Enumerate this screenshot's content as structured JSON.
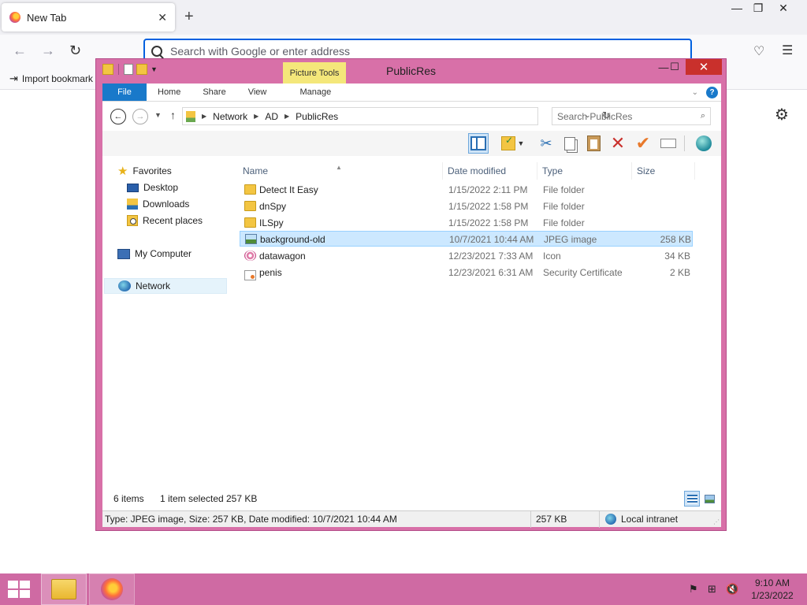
{
  "browser": {
    "tab_title": "New Tab",
    "tab_close": "✕",
    "new_tab": "+",
    "url_placeholder": "Search with Google or enter address",
    "bookmark_import_label": "Import bookmark",
    "window_controls": {
      "minimize": "—",
      "restore": "❐",
      "close": "✕"
    },
    "nav": {
      "back": "←",
      "forward": "→",
      "reload": "↻"
    },
    "icons": [
      "firefox-icon",
      "search-icon",
      "pocket-icon",
      "menu-icon",
      "gear-icon",
      "import-icon"
    ]
  },
  "explorer": {
    "title": "PublicRes",
    "contextual_tab": "Picture Tools",
    "window_controls": {
      "minimize": "—",
      "maximize": "☐",
      "close": "✕"
    },
    "ribbon_tabs": {
      "file": "File",
      "home": "Home",
      "share": "Share",
      "view": "View",
      "manage": "Manage"
    },
    "help_label": "?",
    "breadcrumb": [
      "Network",
      "AD",
      "PublicRes"
    ],
    "search_placeholder": "Search PublicRes",
    "navigation": {
      "favorites": "Favorites",
      "desktop": "Desktop",
      "downloads": "Downloads",
      "recent_places": "Recent places",
      "my_computer": "My Computer",
      "network": "Network"
    },
    "columns": {
      "name": "Name",
      "date_modified": "Date modified",
      "type": "Type",
      "size": "Size"
    },
    "files": [
      {
        "name": "Detect It Easy",
        "date": "1/15/2022 2:11 PM",
        "type": "File folder",
        "size": "",
        "icon": "folder-icon"
      },
      {
        "name": "dnSpy",
        "date": "1/15/2022 1:58 PM",
        "type": "File folder",
        "size": "",
        "icon": "folder-icon"
      },
      {
        "name": "ILSpy",
        "date": "1/15/2022 1:58 PM",
        "type": "File folder",
        "size": "",
        "icon": "folder-icon"
      },
      {
        "name": "background-old",
        "date": "10/7/2021 10:44 AM",
        "type": "JPEG image",
        "size": "258 KB",
        "icon": "jpeg-icon"
      },
      {
        "name": "datawagon",
        "date": "12/23/2021 7:33 AM",
        "type": "Icon",
        "size": "34 KB",
        "icon": "ico-file-icon"
      },
      {
        "name": "penis",
        "date": "12/23/2021 6:31 AM",
        "type": "Security Certificate",
        "size": "2 KB",
        "icon": "certificate-icon"
      }
    ],
    "status": {
      "item_count": "6 items",
      "selected": "1 item selected",
      "selected_size": "257 KB"
    },
    "statusbar": {
      "details": "Type: JPEG image, Size: 257 KB, Date modified: 10/7/2021 10:44 AM",
      "size": "257 KB",
      "zone": "Local intranet"
    },
    "colors": {
      "frame": "#d870a8",
      "file_tab": "#1979ca",
      "context_tab": "#f4e77a",
      "close": "#c9302c",
      "selection": "#cce8ff"
    }
  },
  "taskbar": {
    "time": "9:10 AM",
    "date": "1/23/2022",
    "color": "#cf6aa3"
  }
}
